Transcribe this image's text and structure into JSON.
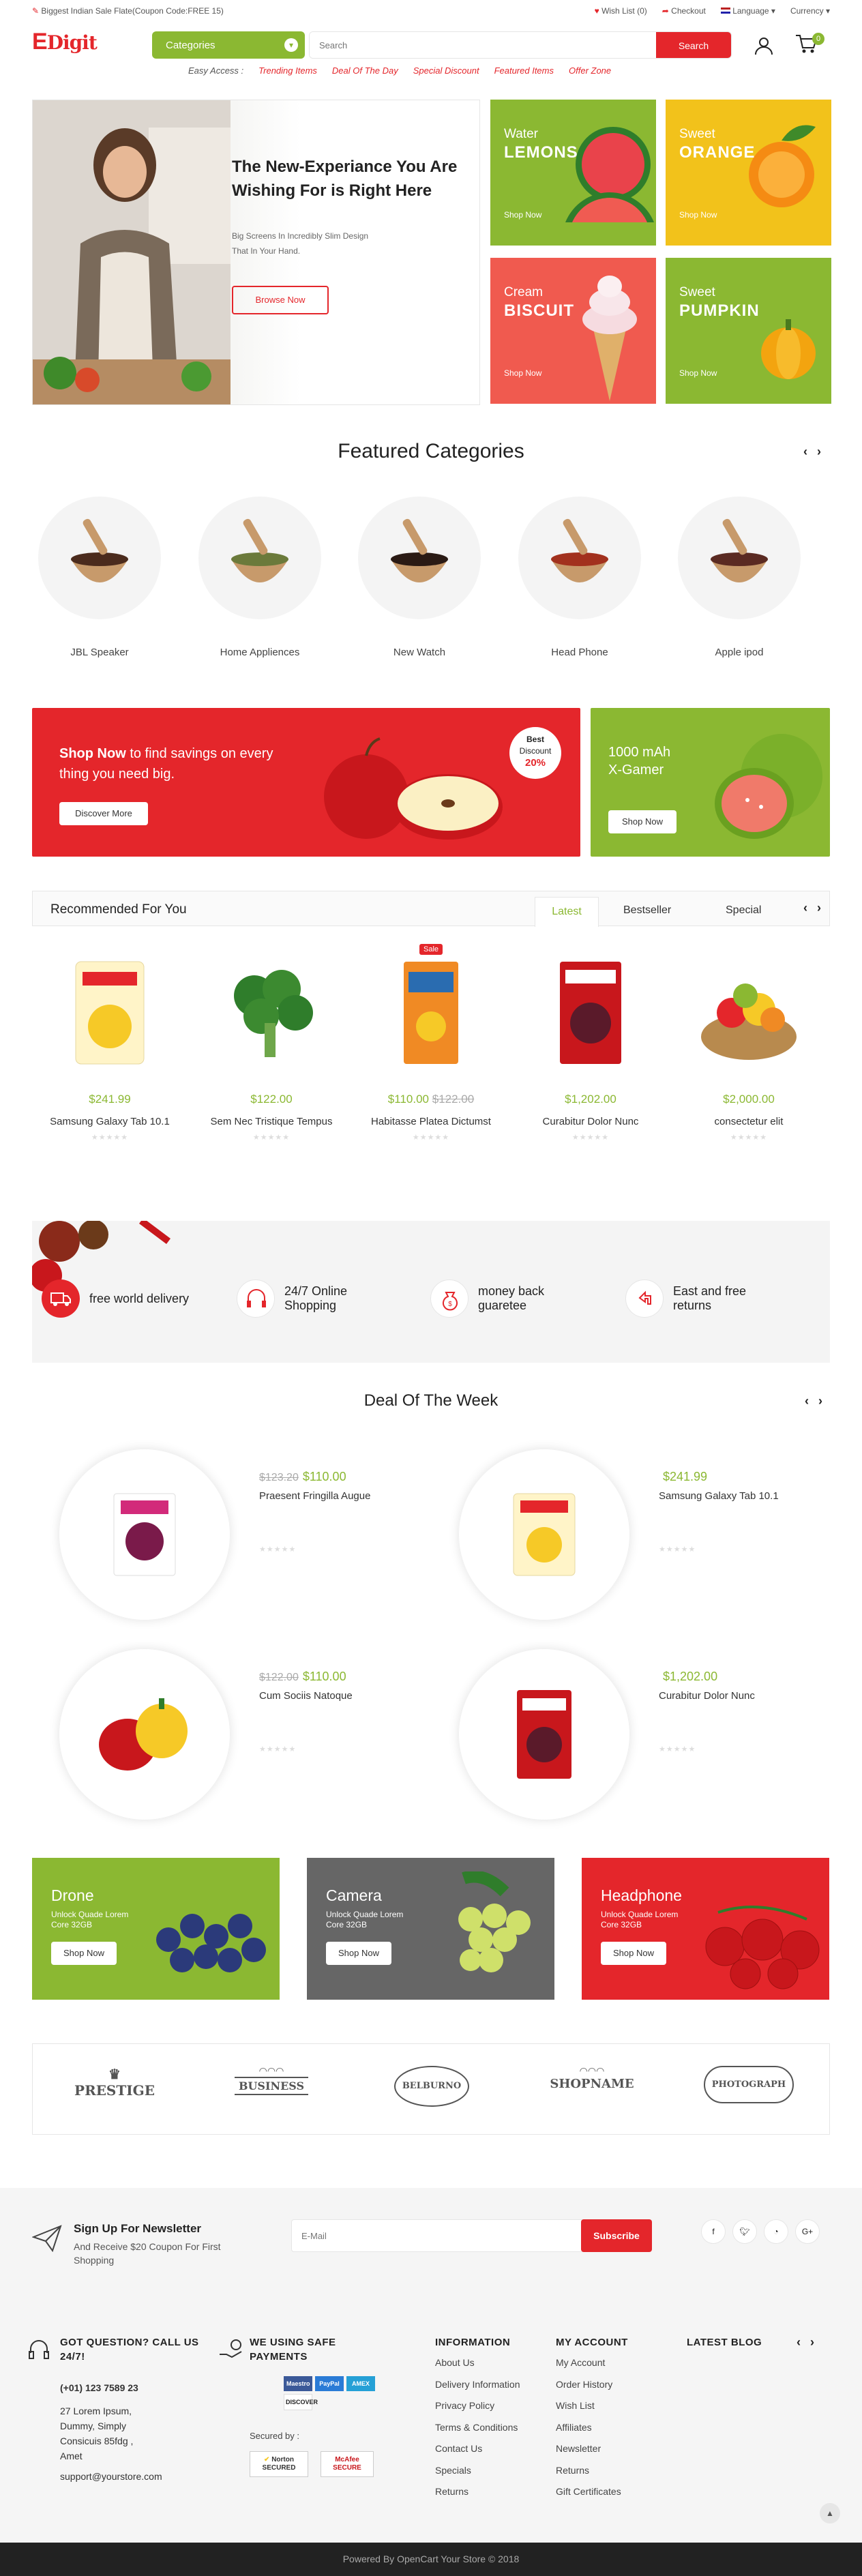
{
  "topbar": {
    "promo": "Biggest Indian Sale Flate(Coupon Code:FREE 15)",
    "wishlist": "Wish List (0)",
    "checkout": "Checkout",
    "language": "Language",
    "currency": "Currency"
  },
  "header": {
    "logo_e": "E",
    "logo_rest": "Digit",
    "categories_label": "Categories",
    "search_placeholder": "Search",
    "search_button": "Search",
    "cart_count": "0"
  },
  "easy_access": {
    "label": "Easy Access :",
    "links": [
      "Trending Items",
      "Deal Of The Day",
      "Special Discount",
      "Featured Items",
      "Offer Zone"
    ]
  },
  "hero": {
    "title_line1": "The New-Experiance You Are",
    "title_line2": "Wishing For is Right Here",
    "sub_line1": "Big Screens In Incredibly Slim Design",
    "sub_line2": "That In Your Hand.",
    "button": "Browse Now"
  },
  "tiles": [
    {
      "t1": "Water",
      "t2": "LEMONS",
      "btn": "Shop Now",
      "color": "#8bb832"
    },
    {
      "t1": "Sweet",
      "t2": "ORANGE",
      "btn": "Shop Now",
      "color": "#f2c21b"
    },
    {
      "t1": "Cream",
      "t2": "BISCUIT",
      "btn": "Shop Now",
      "color": "#f05a4f"
    },
    {
      "t1": "Sweet",
      "t2": "PUMPKIN",
      "btn": "Shop Now",
      "color": "#8bb832"
    }
  ],
  "featured": {
    "title": "Featured Categories",
    "items": [
      "JBL Speaker",
      "Home Appliences",
      "New Watch",
      "Head Phone",
      "Apple ipod"
    ]
  },
  "banner_red": {
    "bold": "Shop Now",
    "rest": " to find savings on every",
    "line2": "thing you need big.",
    "button": "Discover More",
    "badge_l1": "Best",
    "badge_l2": "Discount",
    "badge_l3": "20%"
  },
  "banner_green": {
    "line1": "1000 mAh",
    "line2": "X-Gamer",
    "button": "Shop Now"
  },
  "recommended": {
    "title": "Recommended For You",
    "tabs": [
      "Latest",
      "Bestseller",
      "Special"
    ],
    "sale": "Sale",
    "products": [
      {
        "price": "$241.99",
        "old": "",
        "name": "Samsung Galaxy Tab 10.1"
      },
      {
        "price": "$122.00",
        "old": "",
        "name": "Sem Nec Tristique Tempus"
      },
      {
        "price": "$110.00",
        "old": "$122.00",
        "name": "Habitasse Platea Dictumst"
      },
      {
        "price": "$1,202.00",
        "old": "",
        "name": "Curabitur Dolor Nunc"
      },
      {
        "price": "$2,000.00",
        "old": "",
        "name": "consectetur elit"
      }
    ]
  },
  "services": [
    {
      "icon": "truck-icon",
      "l1": "free world delivery",
      "l2": ""
    },
    {
      "icon": "headset-icon",
      "l1": "24/7 Online",
      "l2": "Shopping"
    },
    {
      "icon": "money-bag-icon",
      "l1": "money back",
      "l2": "guaretee"
    },
    {
      "icon": "return-icon",
      "l1": "East and free",
      "l2": "returns"
    }
  ],
  "deal": {
    "title": "Deal Of The Week",
    "items": [
      {
        "old": "$123.20",
        "price": "$110.00",
        "name": "Praesent Fringilla Augue"
      },
      {
        "old": "",
        "price": "$241.99",
        "name": "Samsung Galaxy Tab 10.1"
      },
      {
        "old": "$122.00",
        "price": "$110.00",
        "name": "Cum Sociis Natoque"
      },
      {
        "old": "",
        "price": "$1,202.00",
        "name": "Curabitur Dolor Nunc"
      }
    ]
  },
  "promo_banners": [
    {
      "title": "Drone",
      "sub1": "Unlock Quade Lorem",
      "sub2": "Core 32GB",
      "btn": "Shop Now",
      "color": "#8bb832"
    },
    {
      "title": "Camera",
      "sub1": "Unlock Quade Lorem",
      "sub2": "Core 32GB",
      "btn": "Shop Now",
      "color": "#666666"
    },
    {
      "title": "Headphone",
      "sub1": "Unlock Quade Lorem",
      "sub2": "Core 32GB",
      "btn": "Shop Now",
      "color": "#e4262b"
    }
  ],
  "brands": [
    "PRESTIGE",
    "BUSINESS",
    "BELBURNO",
    "SHOPNAME",
    "PHOTOGRAPH"
  ],
  "newsletter": {
    "title": "Sign Up For Newsletter",
    "sub1": "And Receive $20 Coupon For First",
    "sub2": "Shopping",
    "placeholder": "E-Mail",
    "button": "Subscribe",
    "social": [
      "f",
      "t",
      "rss",
      "G+"
    ]
  },
  "footer": {
    "q_title1": "GOT QUESTION? CALL US",
    "q_title2": "24/7!",
    "phone": "(+01) 123 7589 23",
    "addr": [
      "27 Lorem Ipsum,",
      "Dummy, Simply",
      "Consicuis 85fdg ,",
      "Amet"
    ],
    "email": "support@yourstore.com",
    "safe1": "WE USING SAFE",
    "safe2": "PAYMENTS",
    "secured": "Secured by :",
    "pay": [
      "Maestro",
      "PayPal",
      "AMEX",
      "DISCOVER"
    ],
    "seals": [
      "Norton SECURED",
      "McAfee SECURE"
    ],
    "info_title": "INFORMATION",
    "info": [
      "About Us",
      "Delivery Information",
      "Privacy Policy",
      "Terms & Conditions",
      "Contact Us",
      "Specials",
      "Returns"
    ],
    "acc_title": "MY ACCOUNT",
    "acc": [
      "My Account",
      "Order History",
      "Wish List",
      "Affiliates",
      "Newsletter",
      "Returns",
      "Gift Certificates"
    ],
    "blog_title": "LATEST BLOG"
  },
  "copyright": "Powered By OpenCart Your Store © 2018"
}
